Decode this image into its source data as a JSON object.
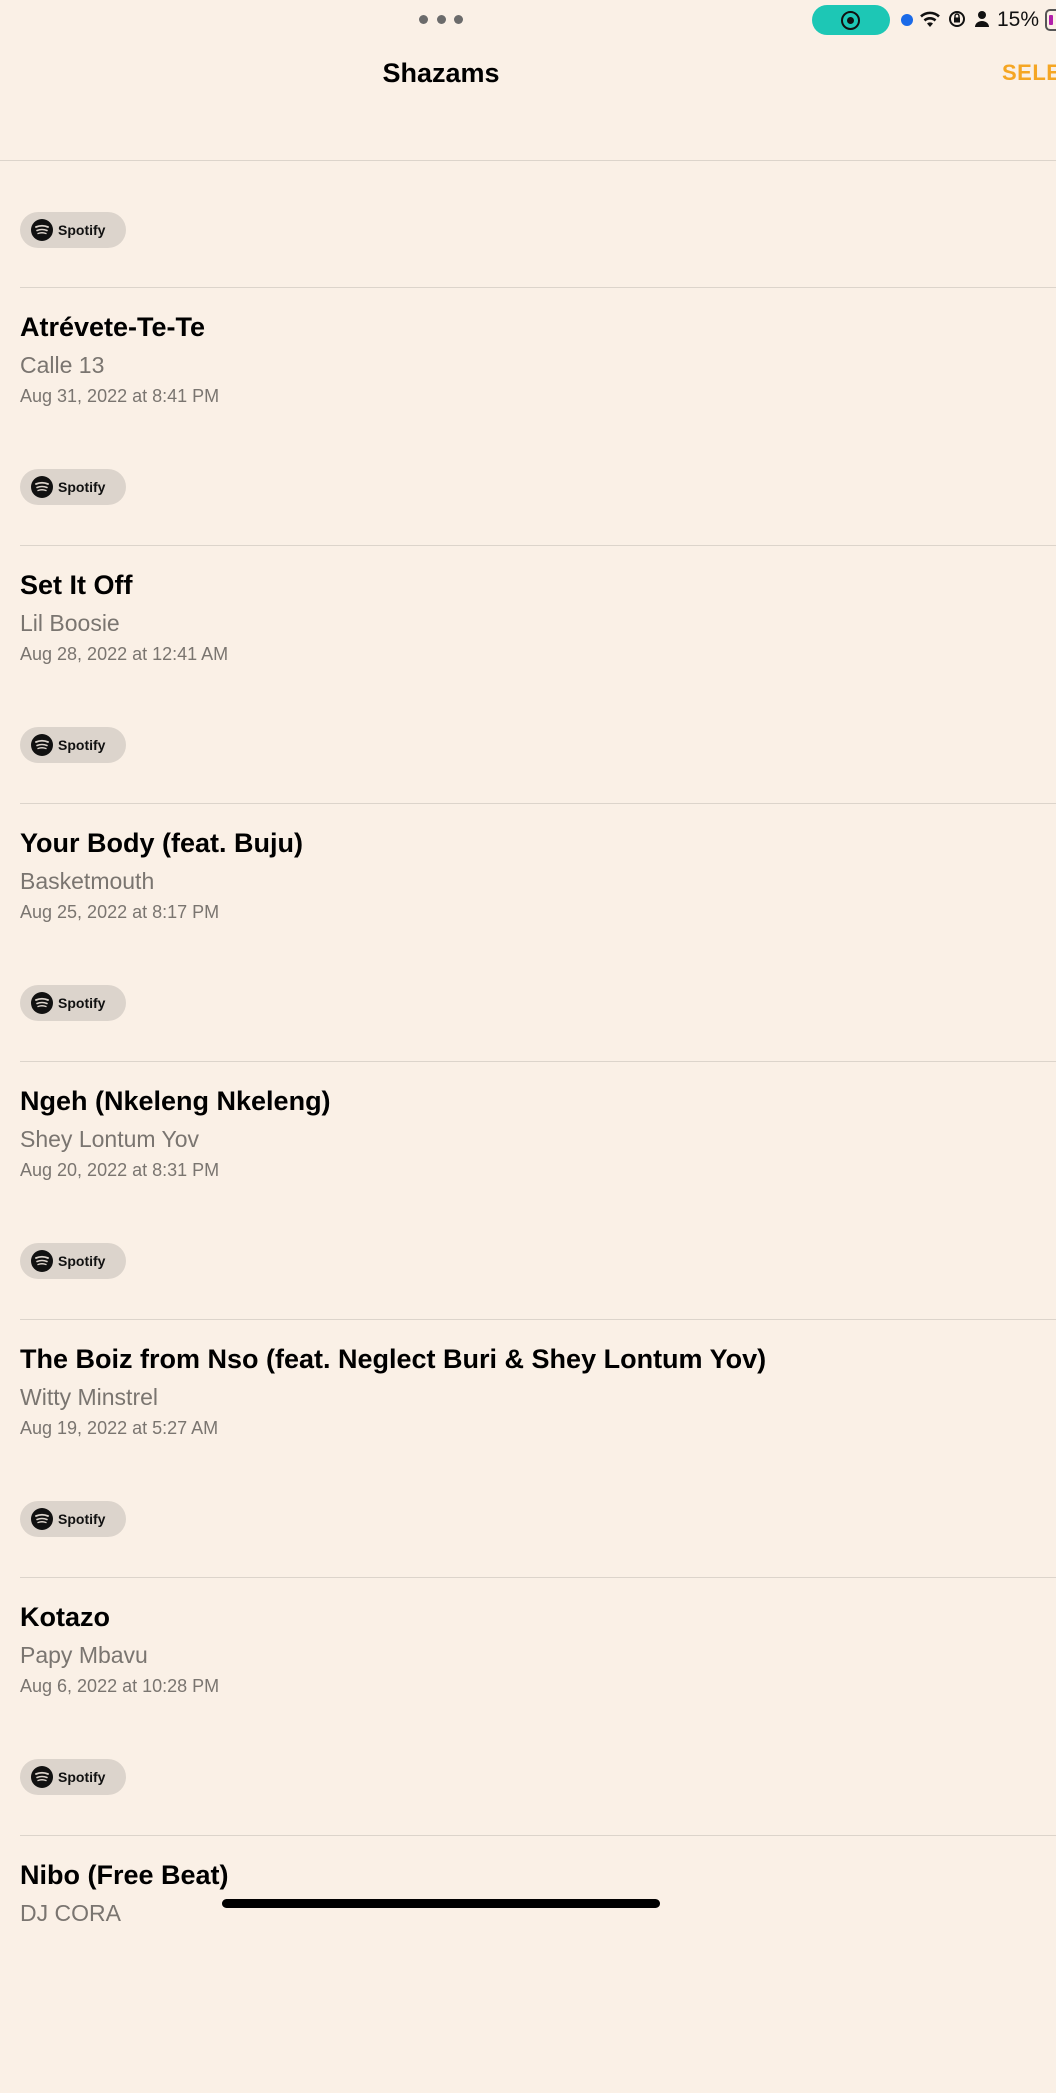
{
  "status_bar": {
    "battery_percent": "15%",
    "record_accent": "#1dc7b5",
    "icons": [
      "more-dots-icon",
      "screen-record-icon",
      "wifi-icon",
      "rotation-lock-icon",
      "person-icon",
      "battery-icon"
    ]
  },
  "navbar": {
    "title": "Shazams",
    "select_label": "SELE"
  },
  "colors": {
    "background": "#faf0e6",
    "accent": "#f5a623",
    "secondary_text": "#7a7570"
  },
  "spotify_label": "Spotify",
  "items": [
    {
      "title": "Atrévete-Te-Te",
      "artist": "Calle 13",
      "date": "Aug 31, 2022 at 8:41 PM"
    },
    {
      "title": "Set It Off",
      "artist": "Lil Boosie",
      "date": "Aug 28, 2022 at 12:41 AM"
    },
    {
      "title": "Your Body (feat. Buju)",
      "artist": "Basketmouth",
      "date": "Aug 25, 2022 at 8:17 PM"
    },
    {
      "title": "Ngeh (Nkeleng Nkeleng)",
      "artist": "Shey Lontum Yov",
      "date": "Aug 20, 2022 at 8:31 PM"
    },
    {
      "title": "The Boiz from Nso (feat. Neglect Buri & Shey Lontum Yov)",
      "artist": "Witty Minstrel",
      "date": "Aug 19, 2022 at 5:27 AM"
    },
    {
      "title": "Kotazo",
      "artist": "Papy Mbavu",
      "date": "Aug 6, 2022 at 10:28 PM"
    },
    {
      "title": "Nibo (Free Beat)",
      "artist": "DJ CORA",
      "date": ""
    }
  ]
}
